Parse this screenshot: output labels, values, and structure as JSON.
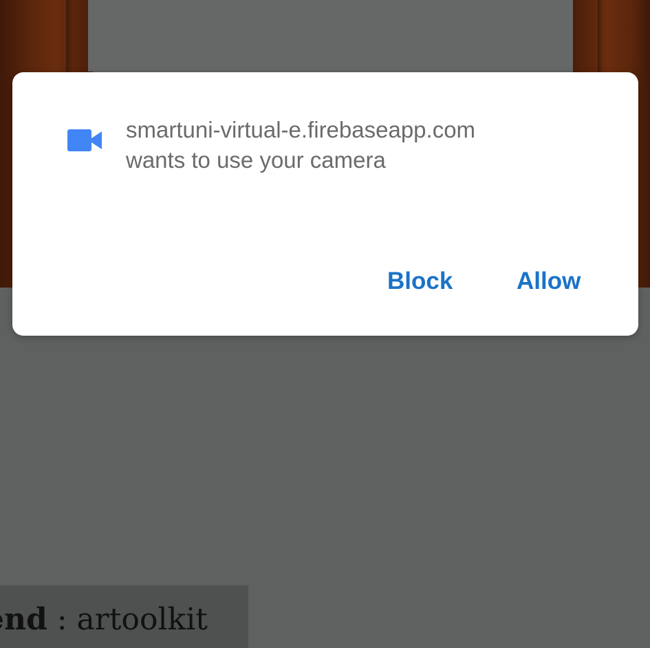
{
  "dialog": {
    "icon": "videocam-icon",
    "origin": "smartuni-virtual-e.firebaseapp.com",
    "request_text": "wants to use your camera",
    "block_label": "Block",
    "allow_label": "Allow"
  },
  "background": {
    "info_line_key": "end",
    "info_line_sep": " : ",
    "info_line_value": "artoolkit",
    "info_line2_prefix": "",
    "info_line2_link": "",
    "colors": {
      "accent": "#1a73c8",
      "camera_icon": "#4285f4",
      "wood": "#5c260c",
      "scrim": "#5f6161"
    }
  }
}
